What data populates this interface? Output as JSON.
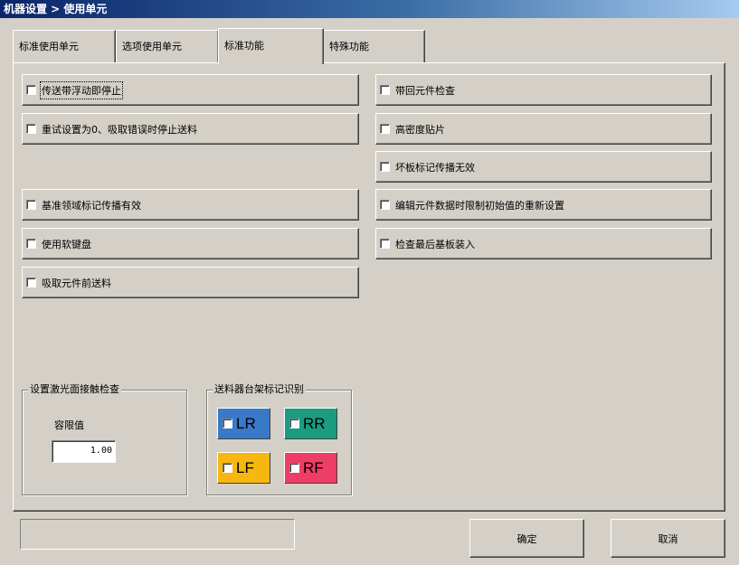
{
  "window": {
    "title": "机器设置 > 使用单元"
  },
  "tabs": [
    {
      "label": "标准使用单元"
    },
    {
      "label": "选项使用单元"
    },
    {
      "label": "标准功能",
      "active": true
    },
    {
      "label": "特殊功能"
    }
  ],
  "left_options": [
    {
      "label": "传送带浮动即停止",
      "checked": false
    },
    {
      "label": "重试设置为0、吸取错误时停止送料",
      "checked": false
    },
    {
      "label": "基准领域标记传播有效",
      "checked": false
    },
    {
      "label": "使用软键盘",
      "checked": false
    },
    {
      "label": "吸取元件前送料",
      "checked": false
    }
  ],
  "right_options": [
    {
      "label": "带回元件检查",
      "checked": false
    },
    {
      "label": "高密度贴片",
      "checked": false
    },
    {
      "label": "坏板标记传播无效",
      "checked": false
    },
    {
      "label": "编辑元件数据时限制初始值的重新设置",
      "checked": false
    },
    {
      "label": "检查最后基板装入",
      "checked": false
    }
  ],
  "laser_group": {
    "title": "设置激光面接触检查",
    "tolerance_label": "容限值",
    "tolerance_value": "1.00"
  },
  "feeder_group": {
    "title": "送料器台架标记识别",
    "buttons": [
      {
        "label": "LR",
        "color": "#3a78c8",
        "checked": false
      },
      {
        "label": "RR",
        "color": "#1a9c80",
        "checked": false
      },
      {
        "label": "LF",
        "color": "#f7b70f",
        "checked": false
      },
      {
        "label": "RF",
        "color": "#ee3d66",
        "checked": false
      }
    ]
  },
  "status_text": "",
  "ok_label": "确定",
  "cancel_label": "取消"
}
